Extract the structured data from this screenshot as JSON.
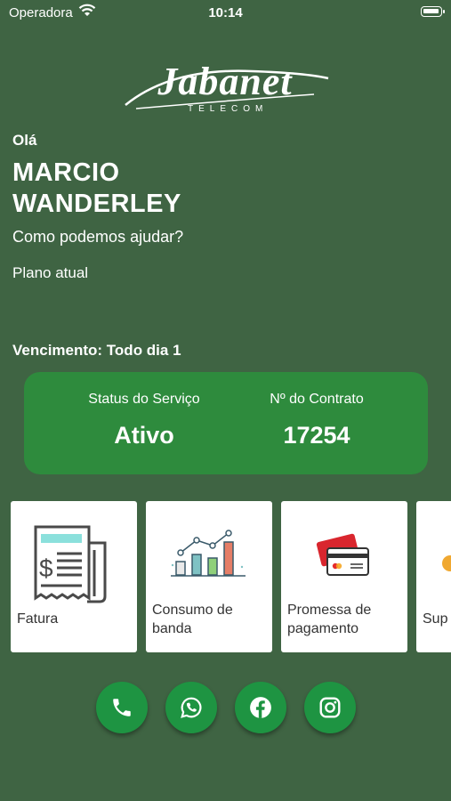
{
  "status_bar": {
    "carrier": "Operadora",
    "time": "10:14",
    "battery_level": 1.0
  },
  "logo": {
    "wordmark": "Jabanet",
    "subtitle": "TELECOM"
  },
  "greeting": "Olá",
  "user": {
    "name": "MARCIO WANDERLEY"
  },
  "help_text": "Como podemos ajudar?",
  "plan_label": "Plano atual",
  "due_label": "Vencimento: Todo dia 1",
  "service": {
    "status_label": "Status do Serviço",
    "status_value": "Ativo",
    "contract_label": "Nº do Contrato",
    "contract_value": "17254"
  },
  "menu": [
    {
      "label": "Fatura",
      "icon": "invoice-icon"
    },
    {
      "label": "Consumo de banda",
      "icon": "bar-chart-icon"
    },
    {
      "label": "Promessa de pagamento",
      "icon": "credit-card-icon"
    },
    {
      "label": "Sup",
      "icon": "support-icon"
    }
  ],
  "social": [
    {
      "icon": "phone-icon"
    },
    {
      "icon": "whatsapp-icon"
    },
    {
      "icon": "facebook-icon"
    },
    {
      "icon": "instagram-icon"
    }
  ],
  "colors": {
    "background": "#3f6443",
    "service_card": "#2e8b3d",
    "social_button": "#1e9442"
  }
}
